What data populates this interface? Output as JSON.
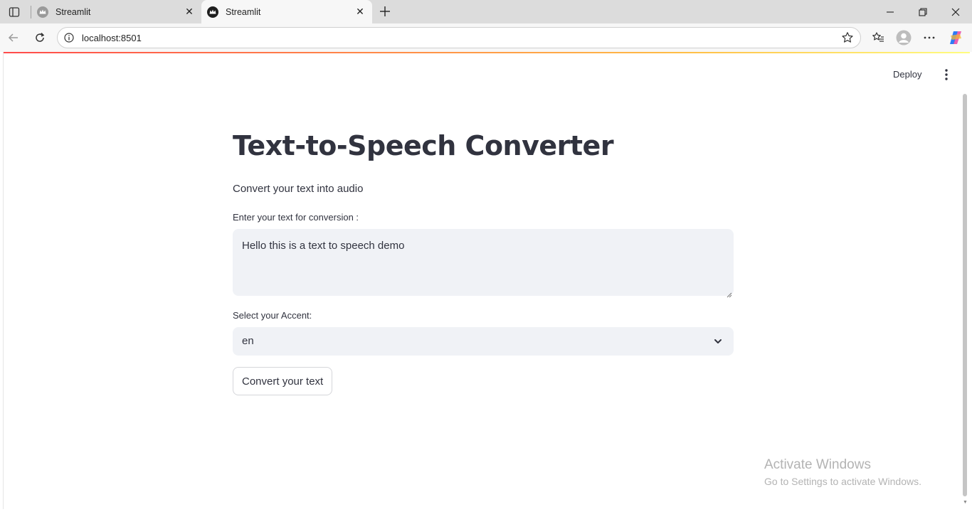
{
  "browser": {
    "tabs": [
      {
        "title": "Streamlit",
        "icon": "streamlit-crown-icon",
        "active": false
      },
      {
        "title": "Streamlit",
        "icon": "streamlit-crown-icon",
        "active": true
      }
    ],
    "url": "localhost:8501"
  },
  "app": {
    "deploy_label": "Deploy",
    "title": "Text-to-Speech Converter",
    "subtitle": "Convert your text into audio",
    "text_input": {
      "label": "Enter your text for conversion :",
      "value": "Hello this is a text to speech demo"
    },
    "accent_select": {
      "label": "Select your Accent:",
      "value": "en"
    },
    "convert_button": "Convert your text"
  },
  "watermark": {
    "line1": "Activate Windows",
    "line2": "Go to Settings to activate Windows."
  },
  "colors": {
    "text": "#31333f",
    "input_bg": "#f0f2f6",
    "accent_red": "#ff4b4b"
  }
}
